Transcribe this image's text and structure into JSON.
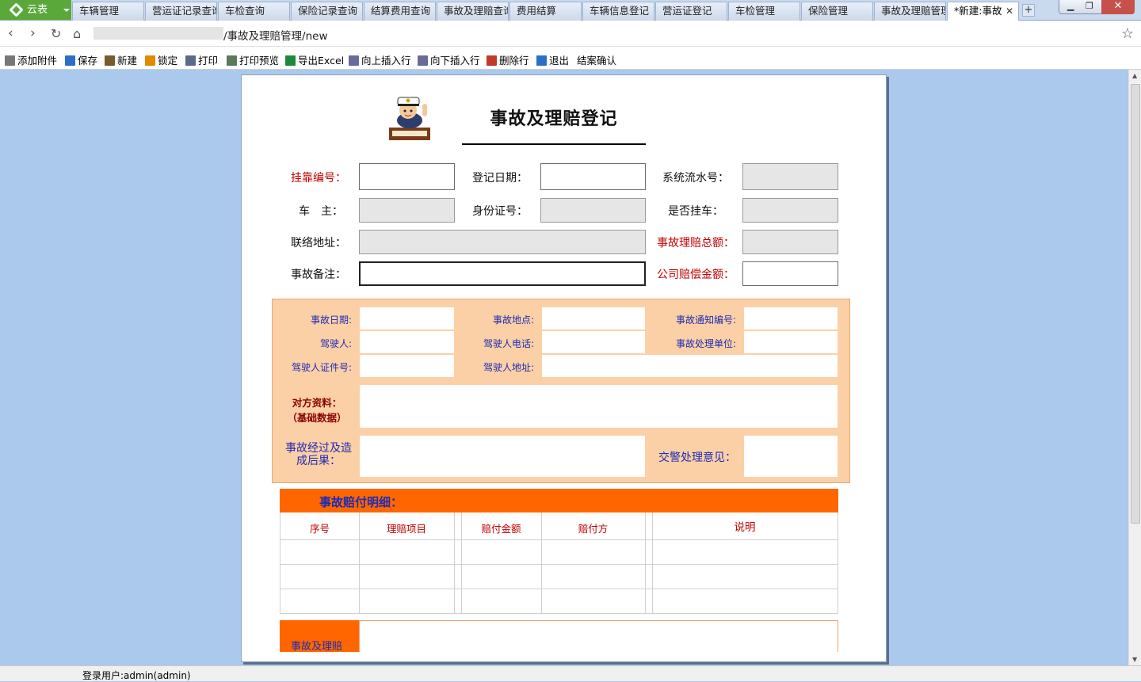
{
  "app": {
    "name": "云表"
  },
  "tabs": [
    {
      "label": "车辆管理"
    },
    {
      "label": "营运证记录查询"
    },
    {
      "label": "车检查询"
    },
    {
      "label": "保险记录查询"
    },
    {
      "label": "结算费用查询"
    },
    {
      "label": "事故及理赔查询"
    },
    {
      "label": "费用结算"
    },
    {
      "label": "车辆信息登记"
    },
    {
      "label": "营运证登记"
    },
    {
      "label": "车检管理"
    },
    {
      "label": "保险管理"
    },
    {
      "label": "事故及理赔管理"
    },
    {
      "label": "*新建:事故",
      "active": true
    }
  ],
  "address": {
    "path": "/事故及理赔管理/new"
  },
  "toolbar": [
    {
      "label": "添加附件",
      "icon": "paperclip-icon"
    },
    {
      "label": "保存",
      "icon": "save-icon"
    },
    {
      "label": "新建",
      "icon": "new-icon"
    },
    {
      "label": "锁定",
      "icon": "lock-icon"
    },
    {
      "label": "打印",
      "icon": "printer-icon"
    },
    {
      "label": "打印预览",
      "icon": "print-preview-icon"
    },
    {
      "label": "导出Excel",
      "icon": "excel-icon"
    },
    {
      "label": "向上插入行",
      "icon": "insert-row-above-icon"
    },
    {
      "label": "向下插入行",
      "icon": "insert-row-below-icon"
    },
    {
      "label": "删除行",
      "icon": "delete-row-icon"
    },
    {
      "label": "退出",
      "icon": "exit-icon"
    },
    {
      "label": "结案确认",
      "icon": ""
    }
  ],
  "form": {
    "title": "事故及理赔登记",
    "labels": {
      "affiliation_no": "挂靠编号：",
      "register_date": "登记日期：",
      "serial_no": "系统流水号：",
      "owner": "车　主：",
      "id_no": "身份证号：",
      "is_affiliated": "是否挂车：",
      "address": "联络地址：",
      "claim_total": "事故理赔总额：",
      "remark": "事故备注：",
      "company_comp": "公司赔偿金额："
    }
  },
  "accident": {
    "date": "事故日期:",
    "place": "事故地点:",
    "notice_no": "事故通知编号:",
    "driver": "驾驶人:",
    "driver_phone": "驾驶人电话:",
    "handling_unit": "事故处理单位:",
    "driver_cert": "驾驶人证件号:",
    "driver_addr": "驾驶人地址:",
    "other_party": "对方资料：",
    "other_party_sub": "（基础数据）",
    "process": "事故经过及造成后果：",
    "police_opinion": "交警处理意见："
  },
  "detail": {
    "title": "事故赔付明细：",
    "columns": [
      "序号",
      "理赔项目",
      "赔付金额",
      "赔付方",
      "说明"
    ]
  },
  "footer_label": "事故及理赔",
  "status": {
    "user": "登录用户:admin(admin)"
  },
  "colors": {
    "accent_orange": "#ff6600",
    "panel_orange": "#fcd0a6",
    "label_blue": "#1f2bb4",
    "label_red": "#c00000",
    "workspace_blue": "#aac9ec"
  }
}
